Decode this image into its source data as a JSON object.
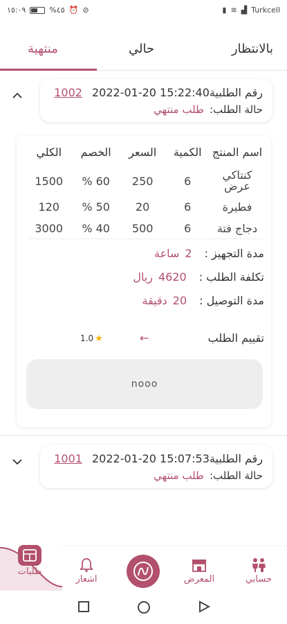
{
  "status_bar": {
    "time": "١٥:٠٩",
    "battery": "%٤٥",
    "carrier": "Turkcell"
  },
  "tabs": [
    {
      "label": "بالانتظار",
      "active": false
    },
    {
      "label": "حالي",
      "active": false
    },
    {
      "label": "منتهية",
      "active": true
    }
  ],
  "labels": {
    "order_number": "رقم الطلبية",
    "order_status": "حالة الطلب:",
    "col_product": "اسم المنتج",
    "col_qty": "الكمية",
    "col_price": "السعر",
    "col_discount": "الخصم",
    "col_total": "الكلي",
    "prep_time": "مدة التجهيز :",
    "order_cost": "تكلفة الطلب :",
    "delivery_time": "مدة التوصيل :",
    "rating": "تقييم الطلب"
  },
  "orders": [
    {
      "number": "1002",
      "datetime": "2022-01-20 15:22:40",
      "status": "طلب منتهي",
      "items": [
        {
          "name": "كنتاكي عرض",
          "qty": "6",
          "price": "250",
          "discount": "60 %",
          "total": "1500"
        },
        {
          "name": "فطيرة",
          "qty": "6",
          "price": "20",
          "discount": "50 %",
          "total": "120"
        },
        {
          "name": "دجاج فتة",
          "qty": "6",
          "price": "500",
          "discount": "40 %",
          "total": "3000"
        }
      ],
      "prep_time_value": "2",
      "prep_time_unit": "ساعة",
      "cost_value": "4620",
      "cost_unit": "ريال",
      "delivery_value": "20",
      "delivery_unit": "دقيقة",
      "rating_value": "1.0",
      "comment": "nooo"
    },
    {
      "number": "1001",
      "datetime": "2022-01-20 15:07:53",
      "status": "طلب منتهي"
    }
  ],
  "bottom_nav": {
    "orders": "طلبات",
    "notifications": "اشعار",
    "gallery": "المعرض",
    "account": "حسابي"
  },
  "colors": {
    "accent": "#b2506d",
    "star": "#f3b400"
  }
}
